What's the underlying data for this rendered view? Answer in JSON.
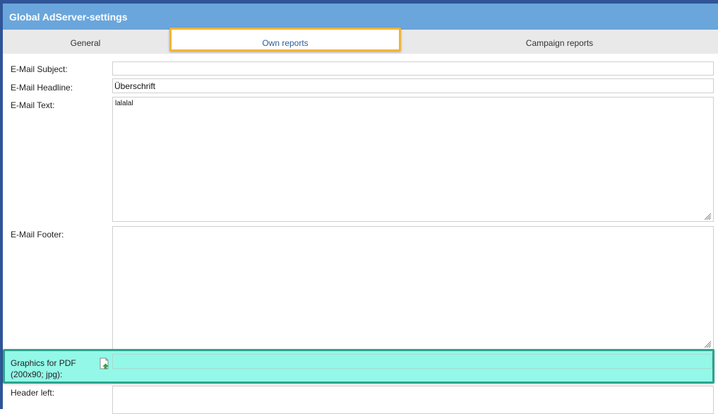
{
  "window": {
    "title": "Global AdServer-settings"
  },
  "tabs": [
    {
      "label": "General"
    },
    {
      "label": "Own reports"
    },
    {
      "label": "Campaign reports"
    }
  ],
  "form": {
    "email_subject": {
      "label": "E-Mail Subject:",
      "value": ""
    },
    "email_headline": {
      "label": "E-Mail Headline:",
      "value": "Überschrift"
    },
    "email_text": {
      "label": "E-Mail Text:",
      "value": "lalalal"
    },
    "email_footer": {
      "label": "E-Mail Footer:",
      "value": ""
    },
    "graphics_pdf": {
      "label_line1": "Graphics for PDF",
      "label_line2": "(200x90; jpg):",
      "icon": "upload-file-icon"
    },
    "header_left": {
      "label": "Header left:"
    }
  },
  "colors": {
    "title_bar": "#6aa6dc",
    "tab_highlight_border": "#f0b43c",
    "row_highlight_bg": "#93f8e8",
    "row_highlight_border": "#2aa58e"
  }
}
